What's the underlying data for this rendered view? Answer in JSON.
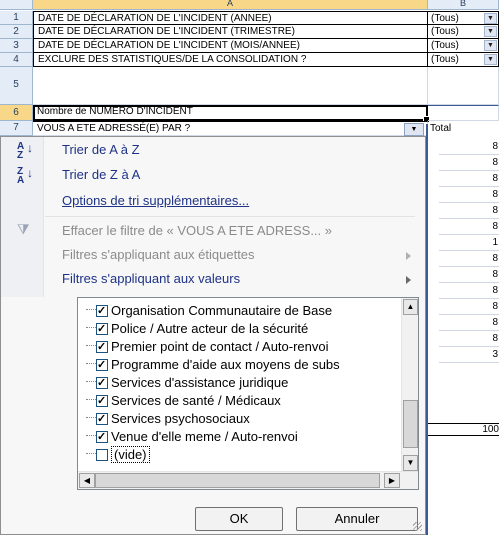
{
  "columns": [
    {
      "label": "A"
    },
    {
      "label": "B"
    }
  ],
  "rows": [
    {
      "num": "1",
      "label": "DATE DE DÉCLARATION DE L'INCIDENT (ANNEE)",
      "filter": "(Tous)"
    },
    {
      "num": "2",
      "label": "DATE DE DÉCLARATION DE L'INCIDENT (TRIMESTRE)",
      "filter": "(Tous)"
    },
    {
      "num": "3",
      "label": "DATE DE DÉCLARATION DE L'INCIDENT (MOIS/ANNEE)",
      "filter": "(Tous)"
    },
    {
      "num": "4",
      "label": "EXCLURE DES STATISTIQUES/DE LA CONSOLIDATION ?",
      "filter": "(Tous)"
    },
    {
      "num": "5",
      "label": ""
    },
    {
      "num": "6",
      "label": "Nombre de NUMERO D'INCIDENT"
    },
    {
      "num": "7",
      "label": "VOUS A ETE ADRESSÉ(E) PAR ?"
    }
  ],
  "total_header": "Total",
  "total_values": [
    "8",
    "8",
    "8",
    "8",
    "8",
    "8",
    "1",
    "8",
    "8",
    "8",
    "8",
    "8",
    "8",
    "3"
  ],
  "grand_total": "100",
  "menu": {
    "sort_az": "Trier de A à Z",
    "sort_za": "Trier de Z à A",
    "more_sort": "Options de tri supplémentaires...",
    "clear_filter": "Effacer le filtre de « VOUS A ETE ADRESS... »",
    "label_filters": "Filtres s'appliquant aux étiquettes",
    "value_filters": "Filtres s'appliquant aux valeurs"
  },
  "list_items": [
    {
      "label": "Organisation Communautaire de Base",
      "checked": true
    },
    {
      "label": "Police / Autre acteur de la sécurité",
      "checked": true
    },
    {
      "label": "Premier point de contact / Auto-renvoi",
      "checked": true
    },
    {
      "label": "Programme d'aide aux moyens de subs",
      "checked": true
    },
    {
      "label": "Services d'assistance juridique",
      "checked": true
    },
    {
      "label": "Services de santé / Médicaux",
      "checked": true
    },
    {
      "label": "Services psychosociaux",
      "checked": true
    },
    {
      "label": "Venue d'elle meme / Auto-renvoi",
      "checked": true
    },
    {
      "label": "(vide)",
      "checked": false
    }
  ],
  "buttons": {
    "ok": "OK",
    "cancel": "Annuler"
  }
}
